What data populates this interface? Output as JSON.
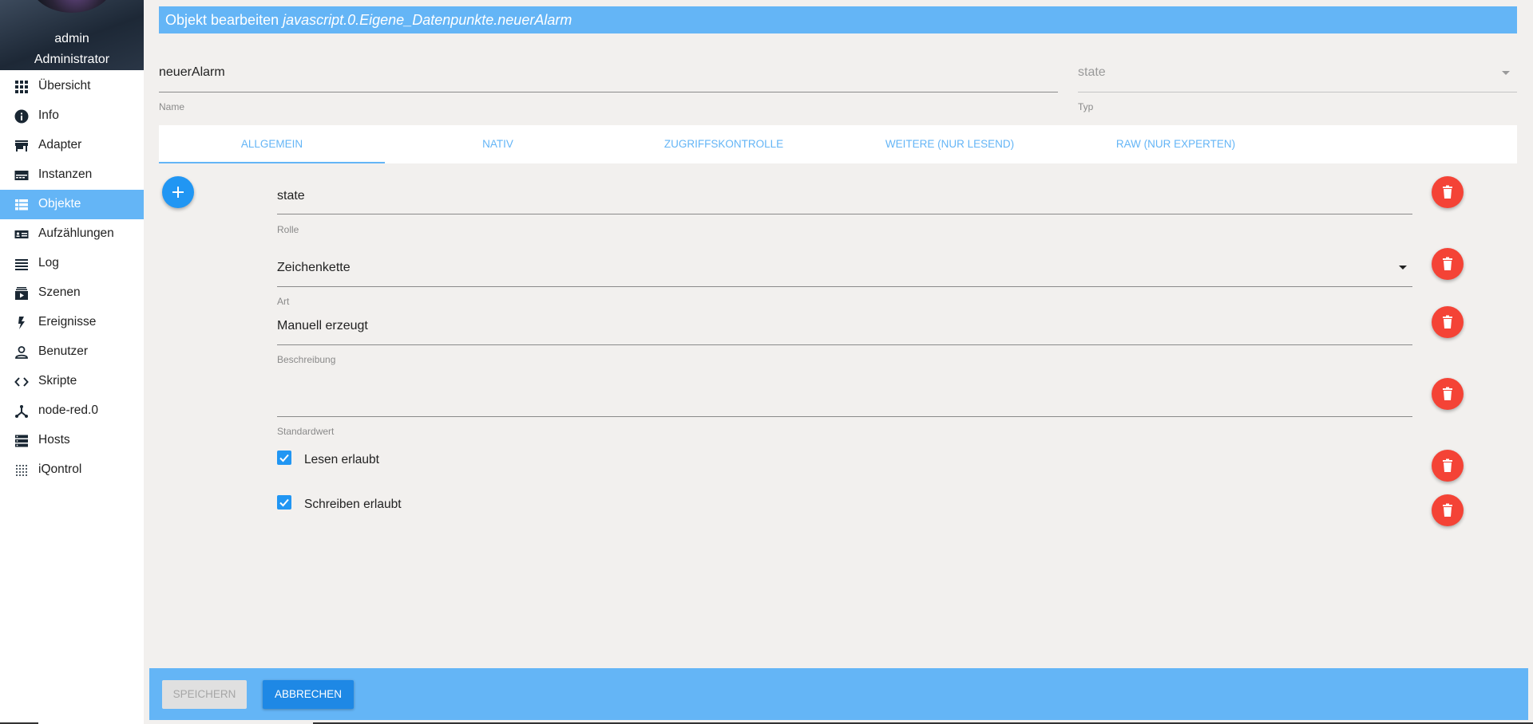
{
  "user": {
    "name": "admin",
    "role": "Administrator"
  },
  "sidebar": {
    "items": [
      {
        "label": "Übersicht",
        "icon": "apps-grid-icon"
      },
      {
        "label": "Info",
        "icon": "info-icon"
      },
      {
        "label": "Adapter",
        "icon": "store-icon"
      },
      {
        "label": "Instanzen",
        "icon": "instances-icon"
      },
      {
        "label": "Objekte",
        "icon": "list-icon",
        "active": true
      },
      {
        "label": "Aufzählungen",
        "icon": "enum-icon"
      },
      {
        "label": "Log",
        "icon": "log-icon"
      },
      {
        "label": "Szenen",
        "icon": "scenes-icon"
      },
      {
        "label": "Ereignisse",
        "icon": "bolt-icon"
      },
      {
        "label": "Benutzer",
        "icon": "user-icon"
      },
      {
        "label": "Skripte",
        "icon": "code-icon"
      },
      {
        "label": "node-red.0",
        "icon": "node-red-icon"
      },
      {
        "label": "Hosts",
        "icon": "hosts-icon"
      },
      {
        "label": "iQontrol",
        "icon": "dots-grid-icon"
      }
    ]
  },
  "dialog": {
    "title_prefix": "Objekt bearbeiten",
    "object_id": "javascript.0.Eigene_Datenpunkte.neuerAlarm",
    "name": {
      "value": "neuerAlarm",
      "label": "Name"
    },
    "type": {
      "value": "state",
      "label": "Typ"
    }
  },
  "tabs": [
    {
      "label": "ALLGEMEIN",
      "active": true
    },
    {
      "label": "NATIV"
    },
    {
      "label": "ZUGRIFFSKONTROLLE"
    },
    {
      "label": "WEITERE (NUR LESEND)"
    },
    {
      "label": "RAW (NUR EXPERTEN)"
    }
  ],
  "fields": {
    "role": {
      "value": "state",
      "label": "Rolle"
    },
    "art": {
      "value": "Zeichenkette",
      "label": "Art"
    },
    "description": {
      "value": "Manuell erzeugt",
      "label": "Beschreibung"
    },
    "default": {
      "value": "",
      "label": "Standardwert"
    },
    "read": {
      "label": "Lesen erlaubt",
      "checked": true
    },
    "write": {
      "label": "Schreiben erlaubt",
      "checked": true
    }
  },
  "footer": {
    "save_label": "SPEICHERN",
    "cancel_label": "ABBRECHEN"
  },
  "colors": {
    "accent": "#64b5f6",
    "primary": "#2196f3",
    "danger": "#f44336",
    "background": "#f2f0ee"
  }
}
